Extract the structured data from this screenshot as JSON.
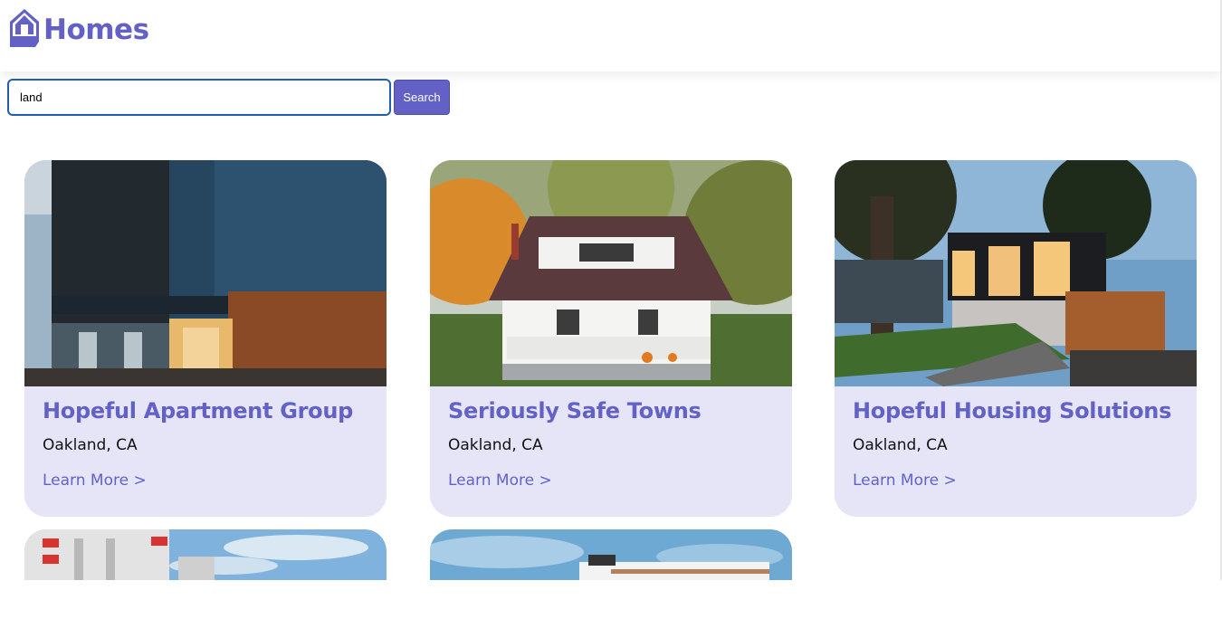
{
  "header": {
    "logo_text": "Homes",
    "logo_icon": "house-icon"
  },
  "search": {
    "value": "land",
    "button_label": "Search"
  },
  "colors": {
    "brand": "#6461c6",
    "card_bg": "#e6e5f8",
    "input_border": "#1f5faf"
  },
  "listings": [
    {
      "title": "Hopeful Apartment Group",
      "location": "Oakland, CA",
      "link": "Learn More >"
    },
    {
      "title": "Seriously Safe Towns",
      "location": "Oakland, CA",
      "link": "Learn More >"
    },
    {
      "title": "Hopeful Housing Solutions",
      "location": "Oakland, CA",
      "link": "Learn More >"
    }
  ]
}
